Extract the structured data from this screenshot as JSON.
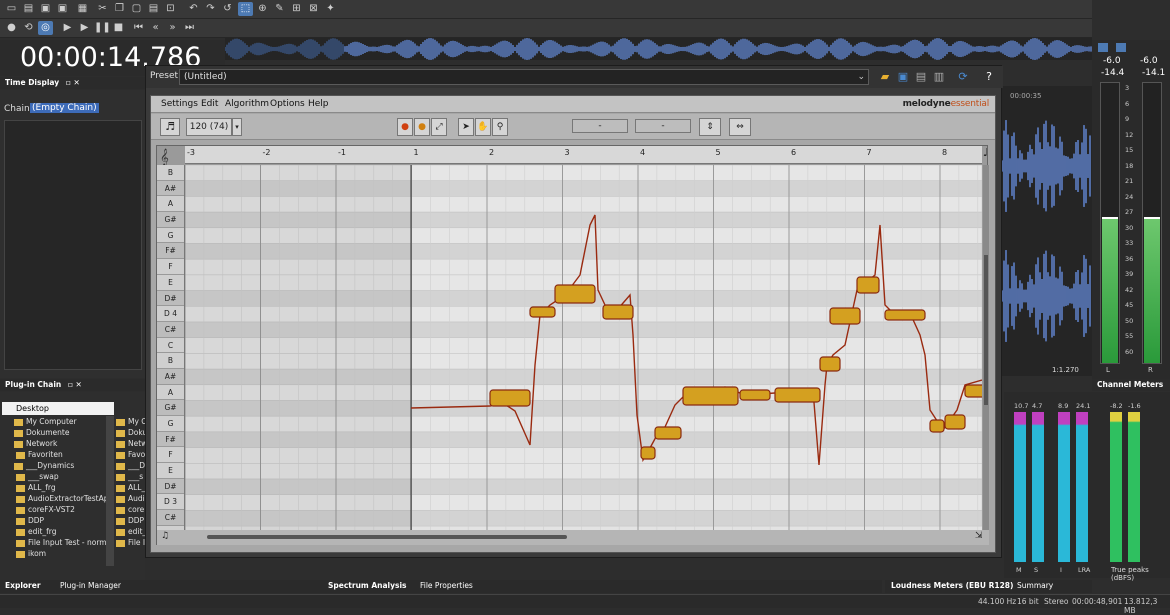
{
  "app": {
    "time_display": "00:00:14.786"
  },
  "panels": {
    "time_display": "Time Display",
    "chain_label": "Chain:",
    "chain_value": "(Empty Chain)",
    "plugin_chain": "Plug-in Chain",
    "explorer_root": "Desktop",
    "explorer_tab": "Explorer",
    "plugin_manager_tab": "Plug-in Manager",
    "spectrum_tab": "Spectrum Analysis",
    "file_props_tab": "File Properties",
    "loudness_tab": "Loudness Meters (EBU R128)",
    "summary_tab": "Summary Information",
    "channel_meters": "Channel Meters"
  },
  "explorer": {
    "items": [
      "Desktop",
      "My Computer",
      "Dokumente",
      "Network",
      "Favoriten",
      "___Dynamics",
      "___swap",
      "ALL_frg",
      "AudioExtractorTestApp",
      "coreFX-VST2",
      "DDP",
      "edit_frg",
      "File Input Test - norme",
      "ikom"
    ],
    "items2": [
      "My C",
      "Doku",
      "Netw",
      "Favo",
      "___D",
      "___s",
      "ALL_",
      "Audi",
      "core",
      "DDP",
      "edit_",
      "File I"
    ]
  },
  "plugin": {
    "preset_label": "Preset:",
    "preset_value": "(Untitled)",
    "menu": [
      "Settings",
      "Edit",
      "Algorithm",
      "Options",
      "Help"
    ],
    "logo_main": "melodyne",
    "logo_sub": "essential",
    "tempo": "120 (74)",
    "field1": "-",
    "field2": "-",
    "ruler": [
      "-3",
      "-2",
      "-1",
      "1",
      "2",
      "3",
      "4",
      "5",
      "6",
      "7",
      "8"
    ],
    "keys": [
      "B",
      "A#",
      "A",
      "G#",
      "G",
      "F#",
      "F",
      "E",
      "D#",
      "D 4",
      "C#",
      "C",
      "B",
      "A#",
      "A",
      "G#",
      "G",
      "F#",
      "F",
      "E",
      "D#",
      "D 3",
      "C#"
    ]
  },
  "meters": {
    "left_val": "-6.0",
    "right_val": "-6.0",
    "left_peak": "-14.4",
    "right_peak": "-14.1",
    "scale": [
      "3",
      "6",
      "9",
      "12",
      "15",
      "18",
      "21",
      "24",
      "27",
      "30",
      "33",
      "36",
      "39",
      "42",
      "45",
      "50",
      "55",
      "60"
    ],
    "lr": [
      "L",
      "R"
    ],
    "loud_top": [
      "10.7",
      "4.7",
      "8.9",
      "24.1",
      "-8.2",
      "-1.6"
    ],
    "loud_labels": [
      "M",
      "S",
      "I",
      "LRA"
    ],
    "true_peaks": "True peaks (dBFS)"
  },
  "wave_ruler": {
    "marker": "00:00:35",
    "ratio": "1:1.270"
  },
  "status": {
    "rate": "44.100 Hz",
    "bits": "16 bit",
    "mode": "Stereo",
    "pos": "00:00:48,901",
    "size": "13.812,3 MB"
  },
  "colors": {
    "accent": "#4d7ab3",
    "blob": "#d4a020",
    "blob_edge": "#8a2a10",
    "meter_green": "#2fc060",
    "meter_cyan": "#2ab8d8",
    "meter_magenta": "#c040c0"
  }
}
